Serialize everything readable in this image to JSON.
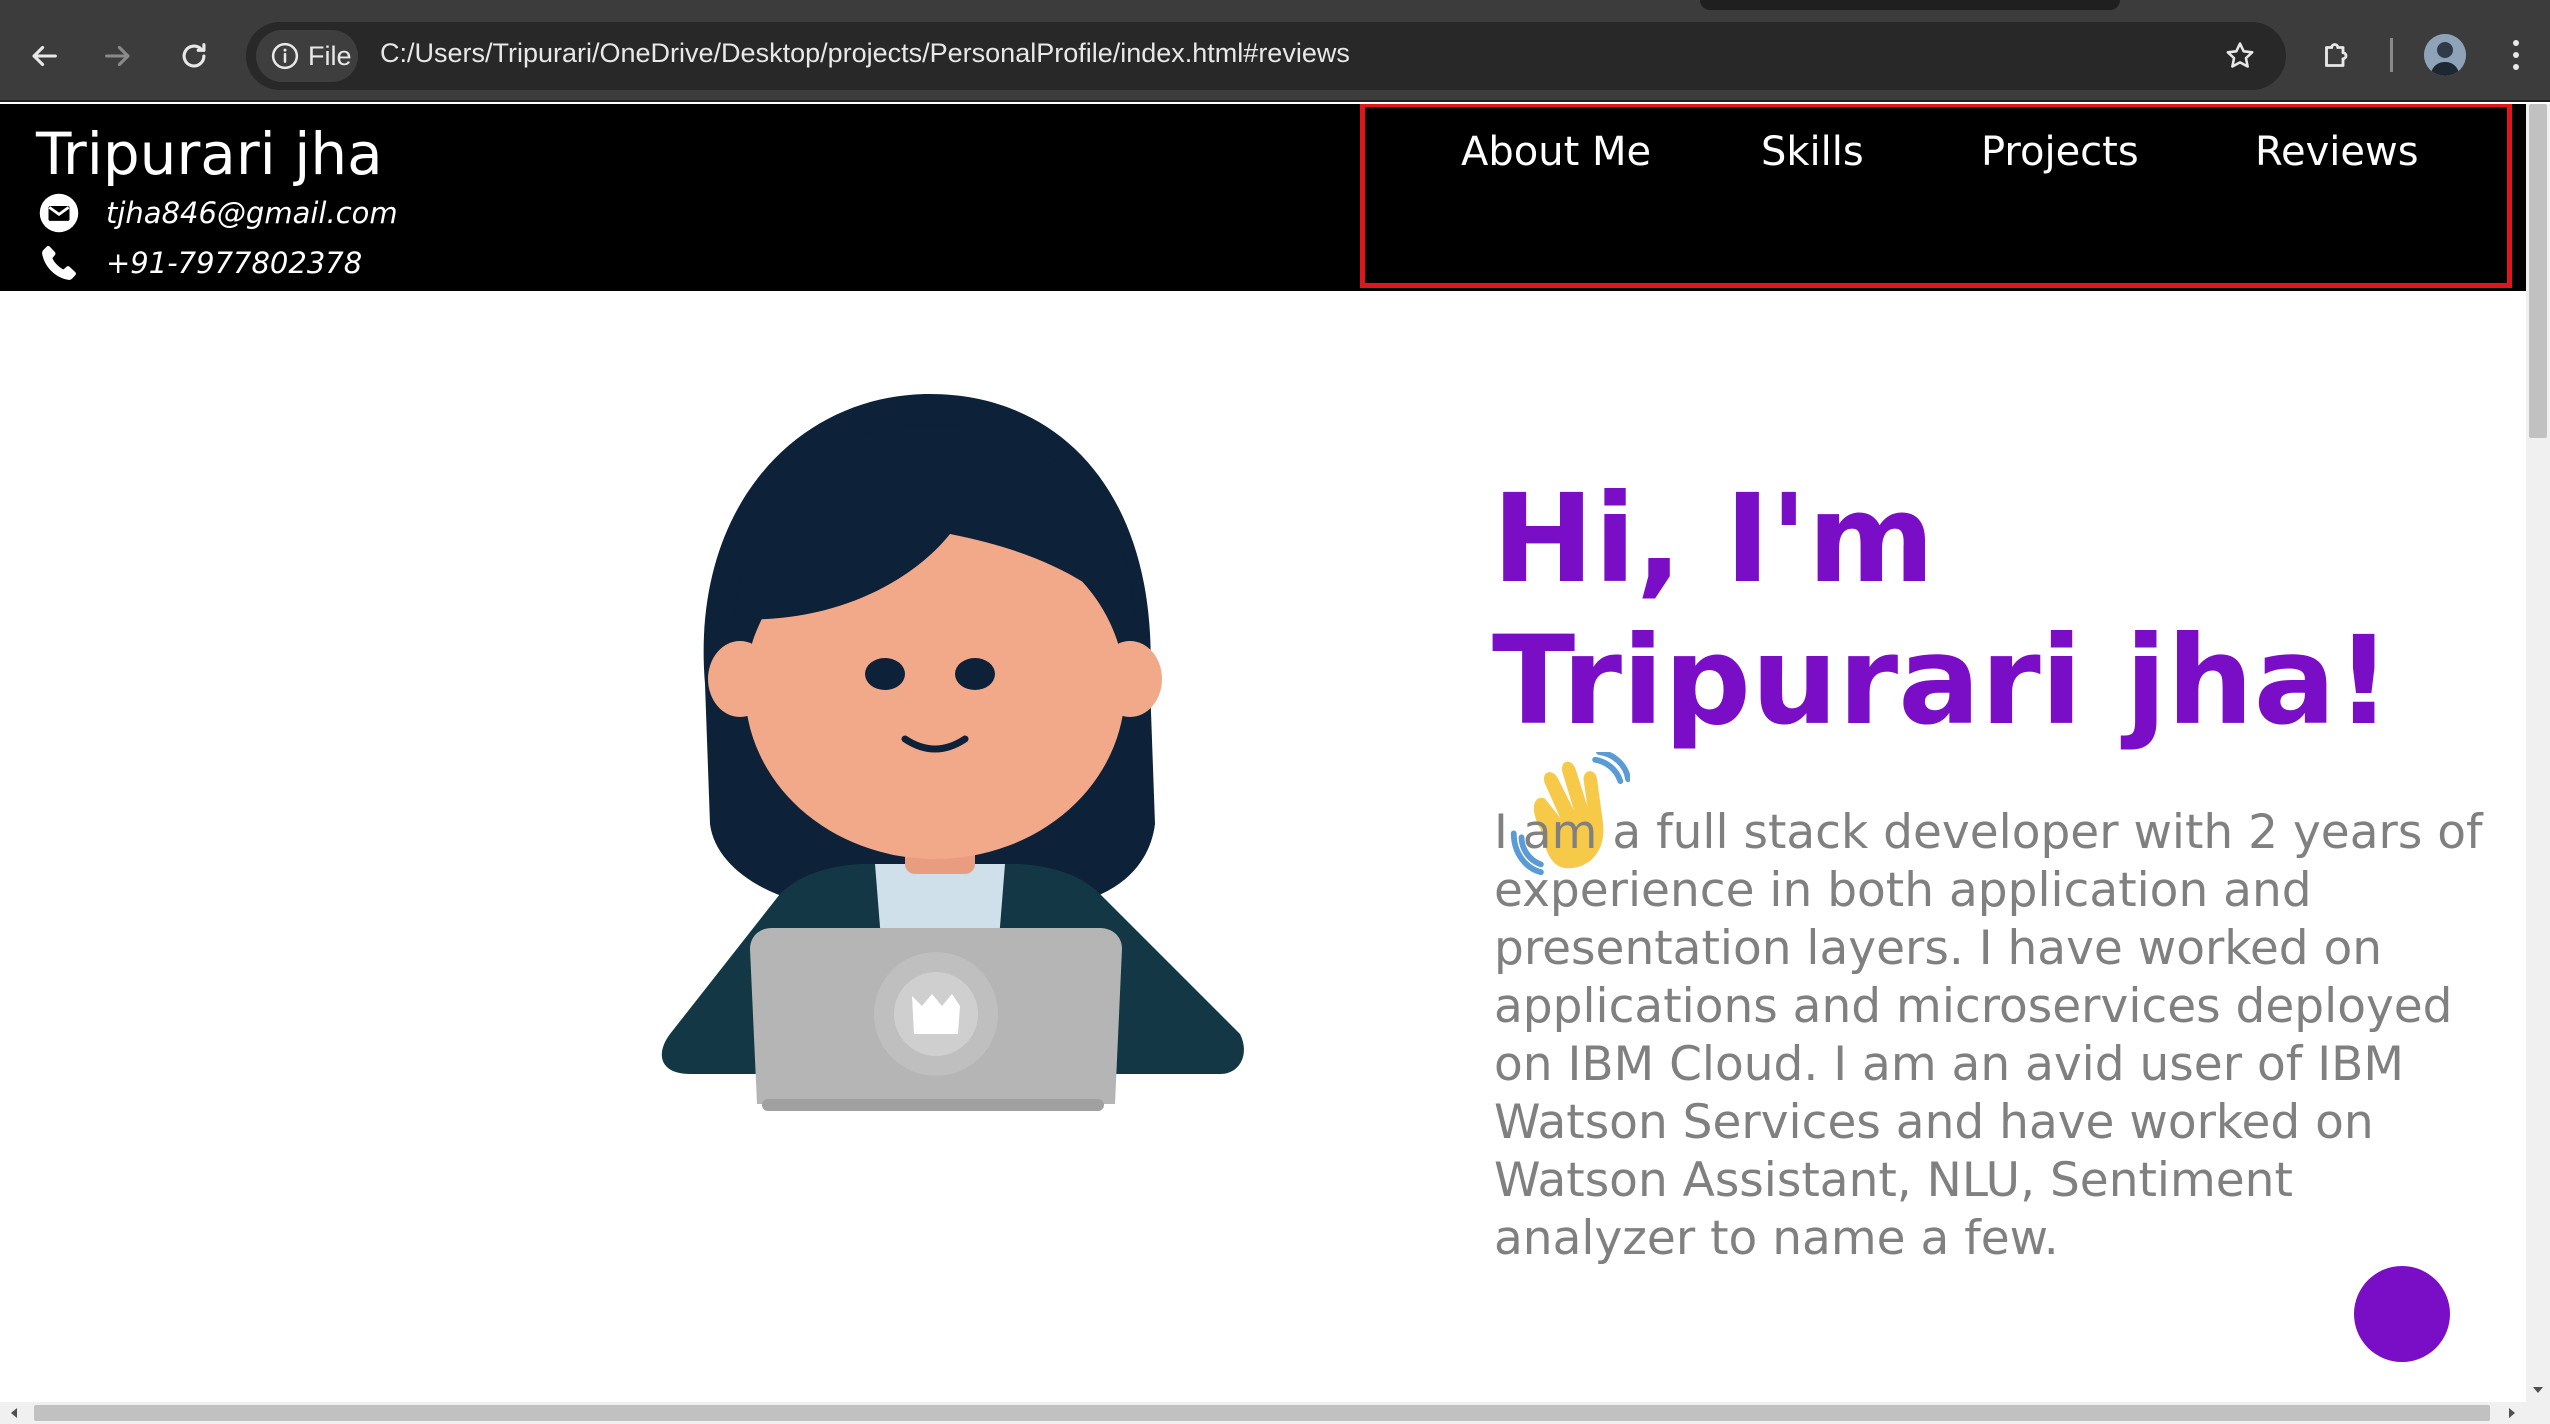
{
  "browser": {
    "site_chip_label": "File",
    "url": "C:/Users/Tripurari/OneDrive/Desktop/projects/PersonalProfile/index.html#reviews"
  },
  "header": {
    "name": "Tripurari jha",
    "email": "tjha846@gmail.com",
    "phone": "+91-7977802378"
  },
  "nav": {
    "items": [
      {
        "label": "About Me"
      },
      {
        "label": "Skills"
      },
      {
        "label": "Projects"
      },
      {
        "label": "Reviews"
      }
    ],
    "highlight_color": "#e0161d"
  },
  "hero": {
    "title": "Hi, I'm Tripurari jha!",
    "bio": "I am a full stack developer with 2 years of experience in both application and presentation layers. I have worked on applications and microservices deployed on IBM Cloud. I am an avid user of IBM Watson Services and have worked on Watson Assistant, NLU, Sentiment analyzer to name a few."
  },
  "colors": {
    "accent": "#7a0ec6",
    "header_bg": "#000000",
    "bio_text": "#808080"
  },
  "icons": {
    "email": "email-icon",
    "phone": "phone-icon",
    "wave": "waving-hand-icon"
  }
}
